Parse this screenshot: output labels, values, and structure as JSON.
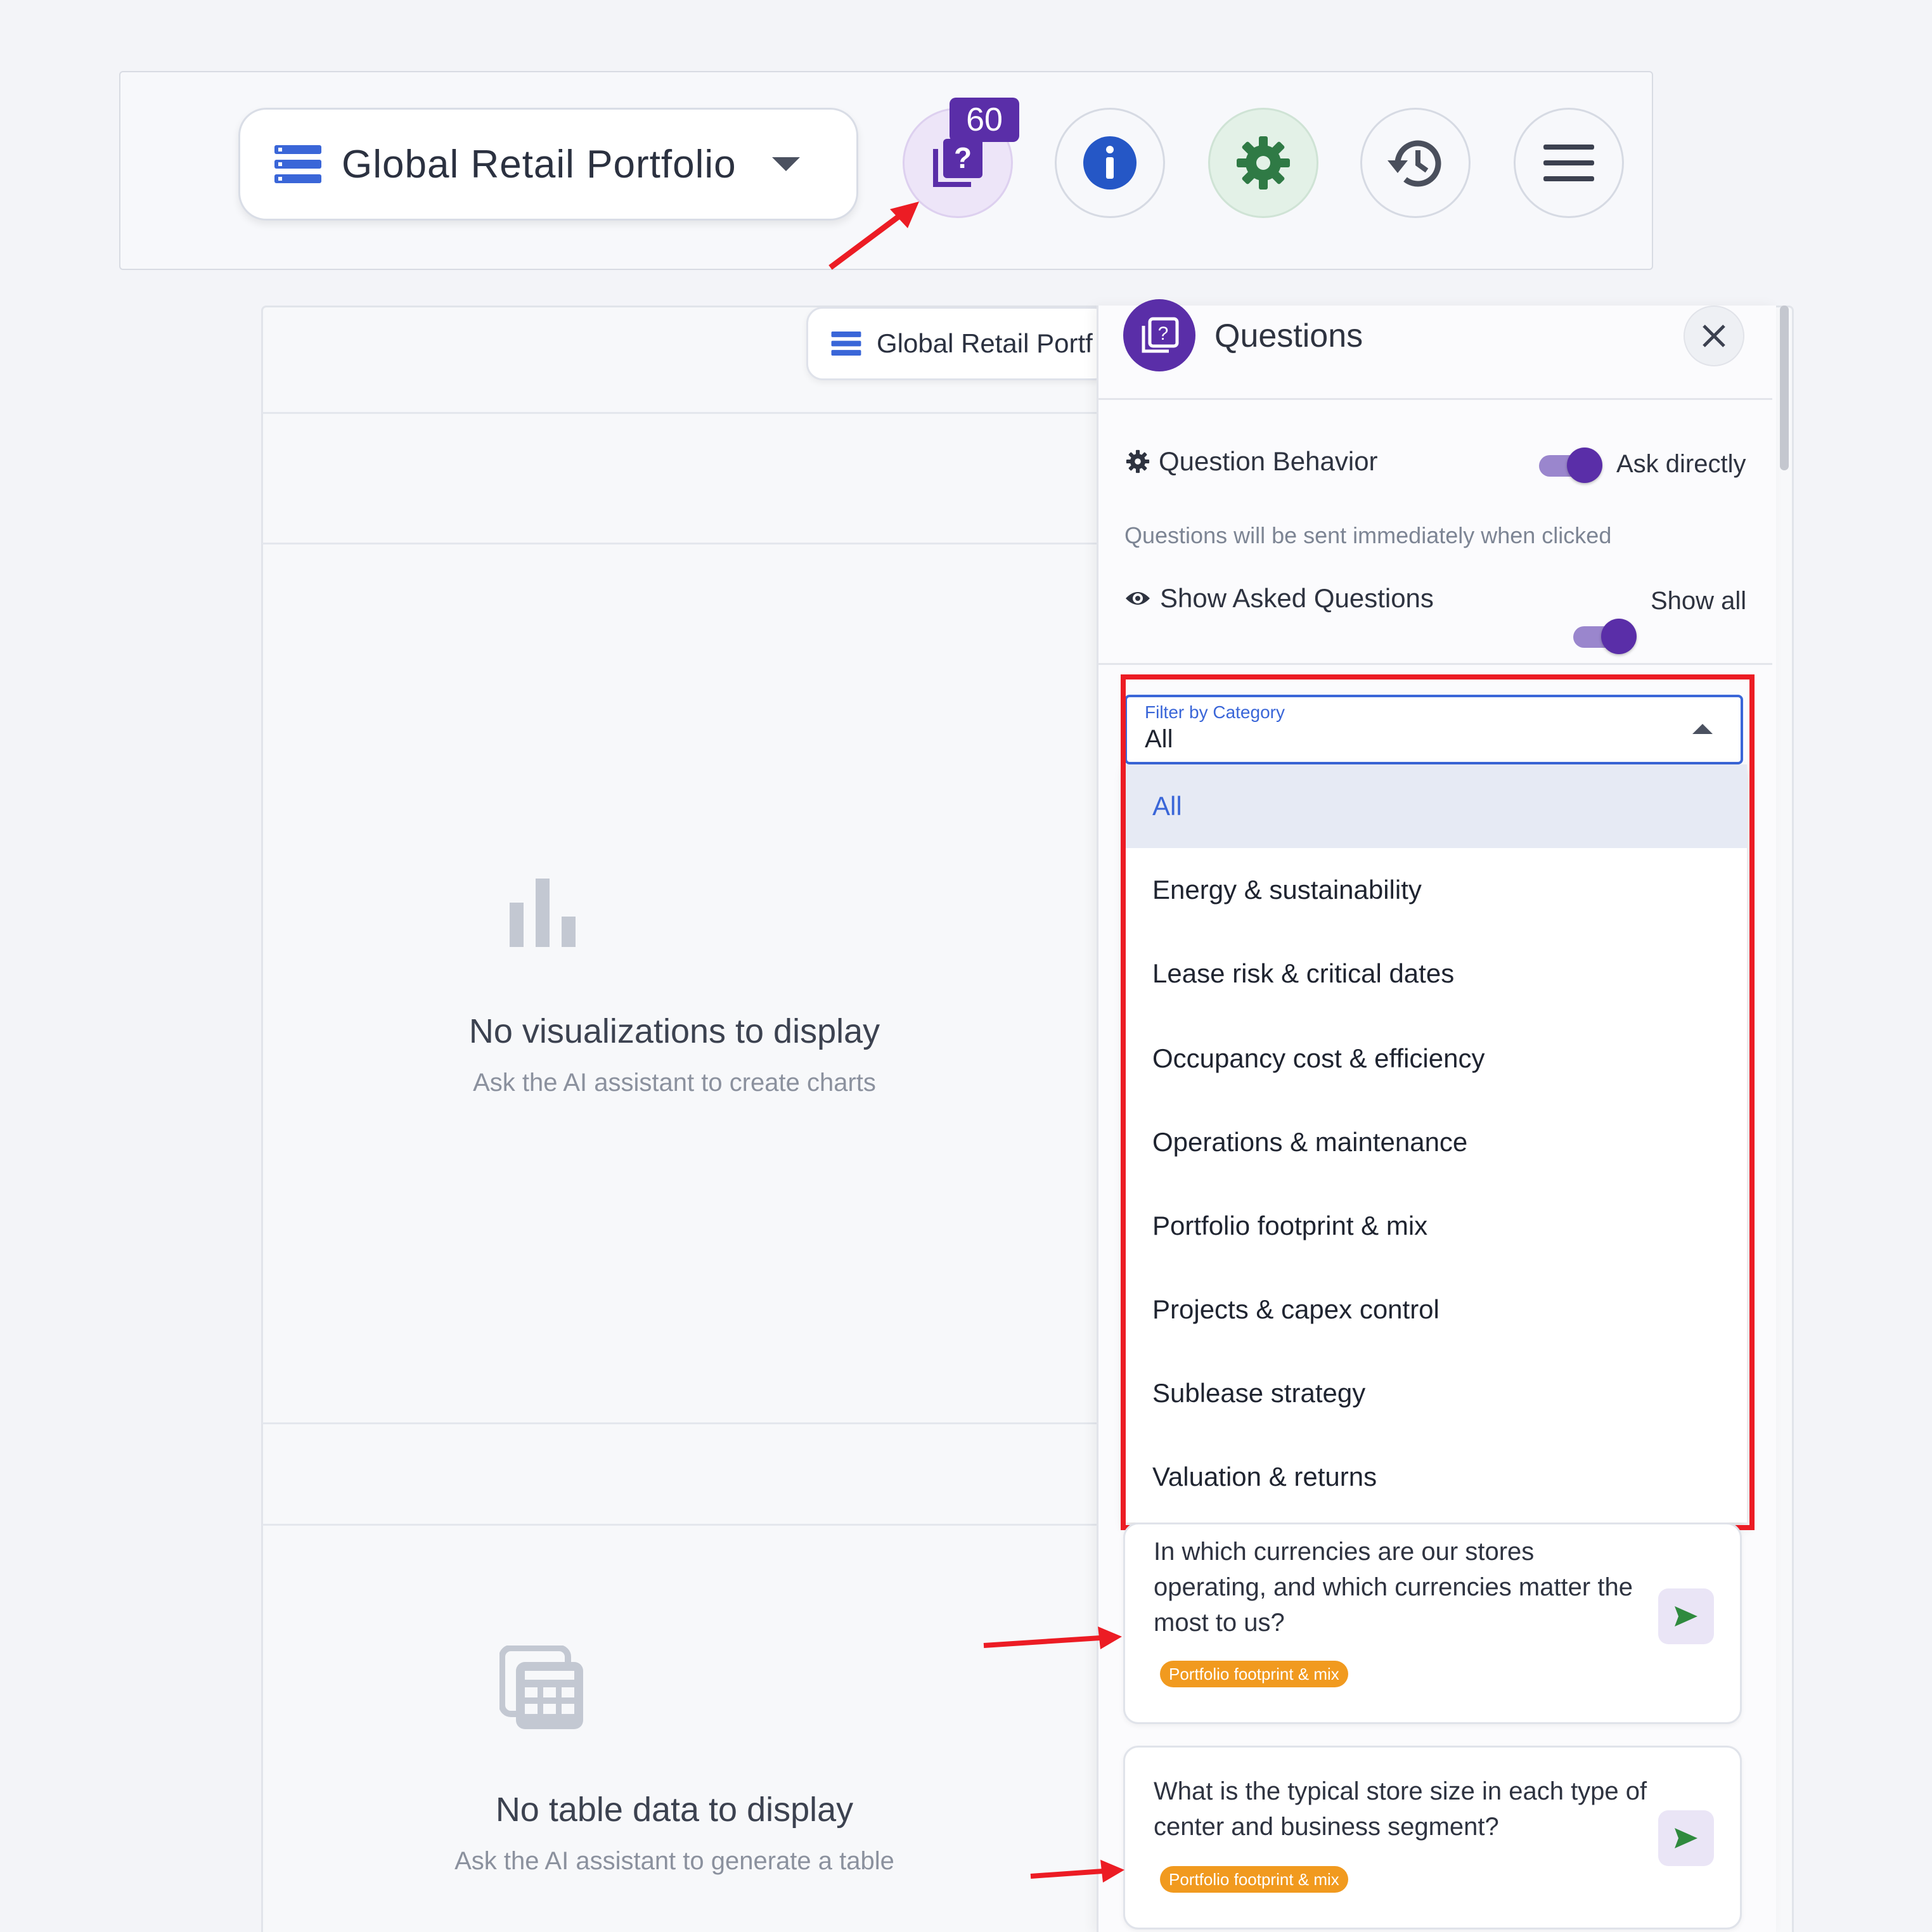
{
  "toolbar": {
    "dataset_name": "Global Retail Portfolio",
    "questions_badge_count": "60"
  },
  "inner_selector": {
    "dataset_name": "Global Retail Portf"
  },
  "empty_states": {
    "visualizations": {
      "title": "No visualizations to display",
      "subtitle": "Ask the AI assistant to create charts"
    },
    "table": {
      "title": "No table data to display",
      "subtitle": "Ask the AI assistant to generate a table"
    }
  },
  "panel": {
    "title": "Questions",
    "question_behavior": {
      "label": "Question Behavior",
      "value": "Ask directly",
      "hint": "Questions will be sent immediately when clicked"
    },
    "show_asked": {
      "label": "Show Asked Questions",
      "value": "Show all"
    },
    "filter": {
      "label": "Filter by Category",
      "value": "All",
      "options": [
        "All",
        "Energy & sustainability",
        "Lease risk & critical dates",
        "Occupancy cost & efficiency",
        "Operations & maintenance",
        "Portfolio footprint & mix",
        "Projects & capex control",
        "Sublease strategy",
        "Valuation & returns"
      ]
    },
    "questions": [
      {
        "text": "In which currencies are our stores operating, and which currencies matter the most to us?",
        "tag": "Portfolio footprint & mix"
      },
      {
        "text": "What is the typical store size in each type of center and business segment?",
        "tag": "Portfolio footprint & mix"
      }
    ]
  },
  "colors": {
    "accent_purple": "#5a2ea8",
    "select_blue": "#3a66d8",
    "annotation_red": "#ec1c24",
    "tag_orange": "#f19a1f",
    "info_blue": "#2557c6",
    "settings_green": "#2f7a45"
  },
  "icons": {
    "dataset": "database-list-icon",
    "questions": "question-stack-icon",
    "info": "info-icon",
    "settings": "gear-icon",
    "history": "history-icon",
    "menu": "hamburger-menu-icon",
    "close": "close-icon",
    "send": "send-icon",
    "visibility": "eye-icon",
    "bar_chart": "bar-chart-icon",
    "table": "table-icon"
  }
}
